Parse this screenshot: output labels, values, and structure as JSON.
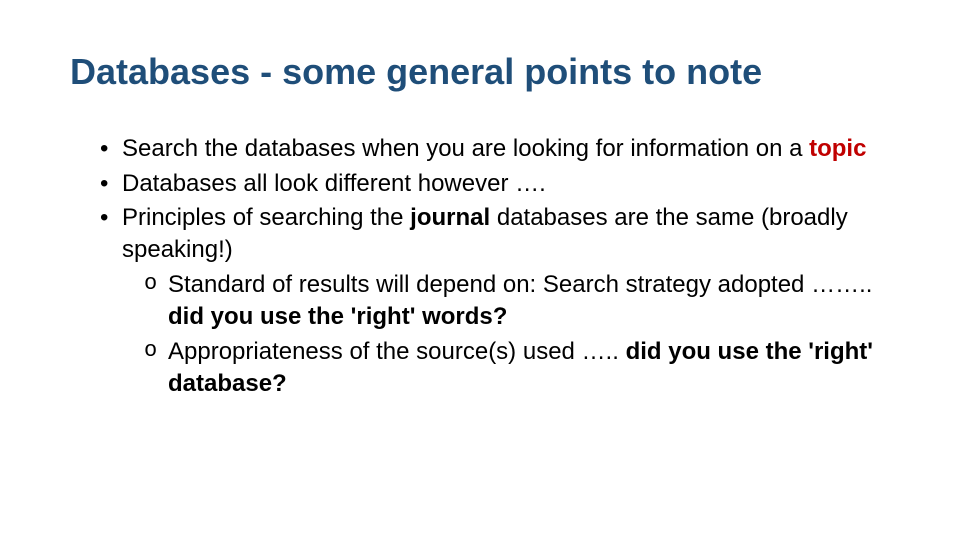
{
  "title": "Databases - some general points to note",
  "bullets": {
    "b1_pre": "Search the databases when you are looking for information on a ",
    "b1_topic": "topic",
    "b2": "Databases all look different however ….",
    "b3_pre": "Principles of searching the ",
    "b3_journal": "journal",
    "b3_post": " databases are the same (broadly speaking!)",
    "sub1_pre": "Standard of results will depend on: Search strategy adopted …….. ",
    "sub1_bold": "did you use the 'right' words?",
    "sub2_pre": " Appropriateness of the source(s) used ….. ",
    "sub2_bold": "did you use the 'right' database?"
  }
}
